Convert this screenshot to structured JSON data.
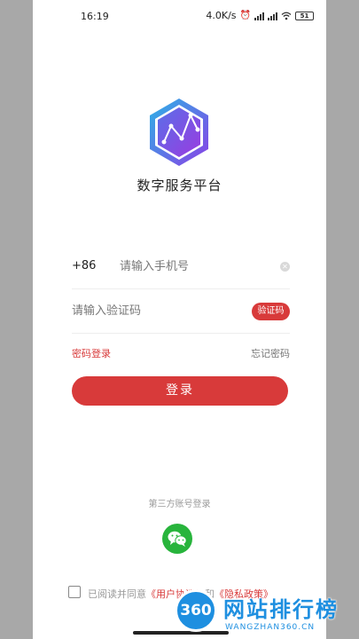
{
  "status_bar": {
    "time": "16:19",
    "net_speed": "4.0K/s",
    "battery": "51"
  },
  "app": {
    "title": "数字服务平台",
    "logo_icon": "hexagon-chart-logo-icon"
  },
  "phone": {
    "country_code": "+86",
    "placeholder": "请输入手机号"
  },
  "code": {
    "placeholder": "请输入验证码",
    "button_label": "验证码"
  },
  "links": {
    "password_login": "密码登录",
    "forgot_password": "忘记密码"
  },
  "login_button": "登录",
  "third_party": {
    "label": "第三方账号登录",
    "wechat_icon": "wechat-icon"
  },
  "agreement": {
    "prefix": "已阅读并同意",
    "user_agreement": "《用户协议》",
    "and": "和",
    "privacy_policy": "《隐私政策》"
  },
  "watermark": {
    "badge": "360",
    "title": "网站排行榜",
    "subtitle": "WANGZHAN360.CN"
  },
  "colors": {
    "accent": "#d83a3a",
    "wechat": "#28b43c",
    "watermark": "#1e8fe0"
  }
}
